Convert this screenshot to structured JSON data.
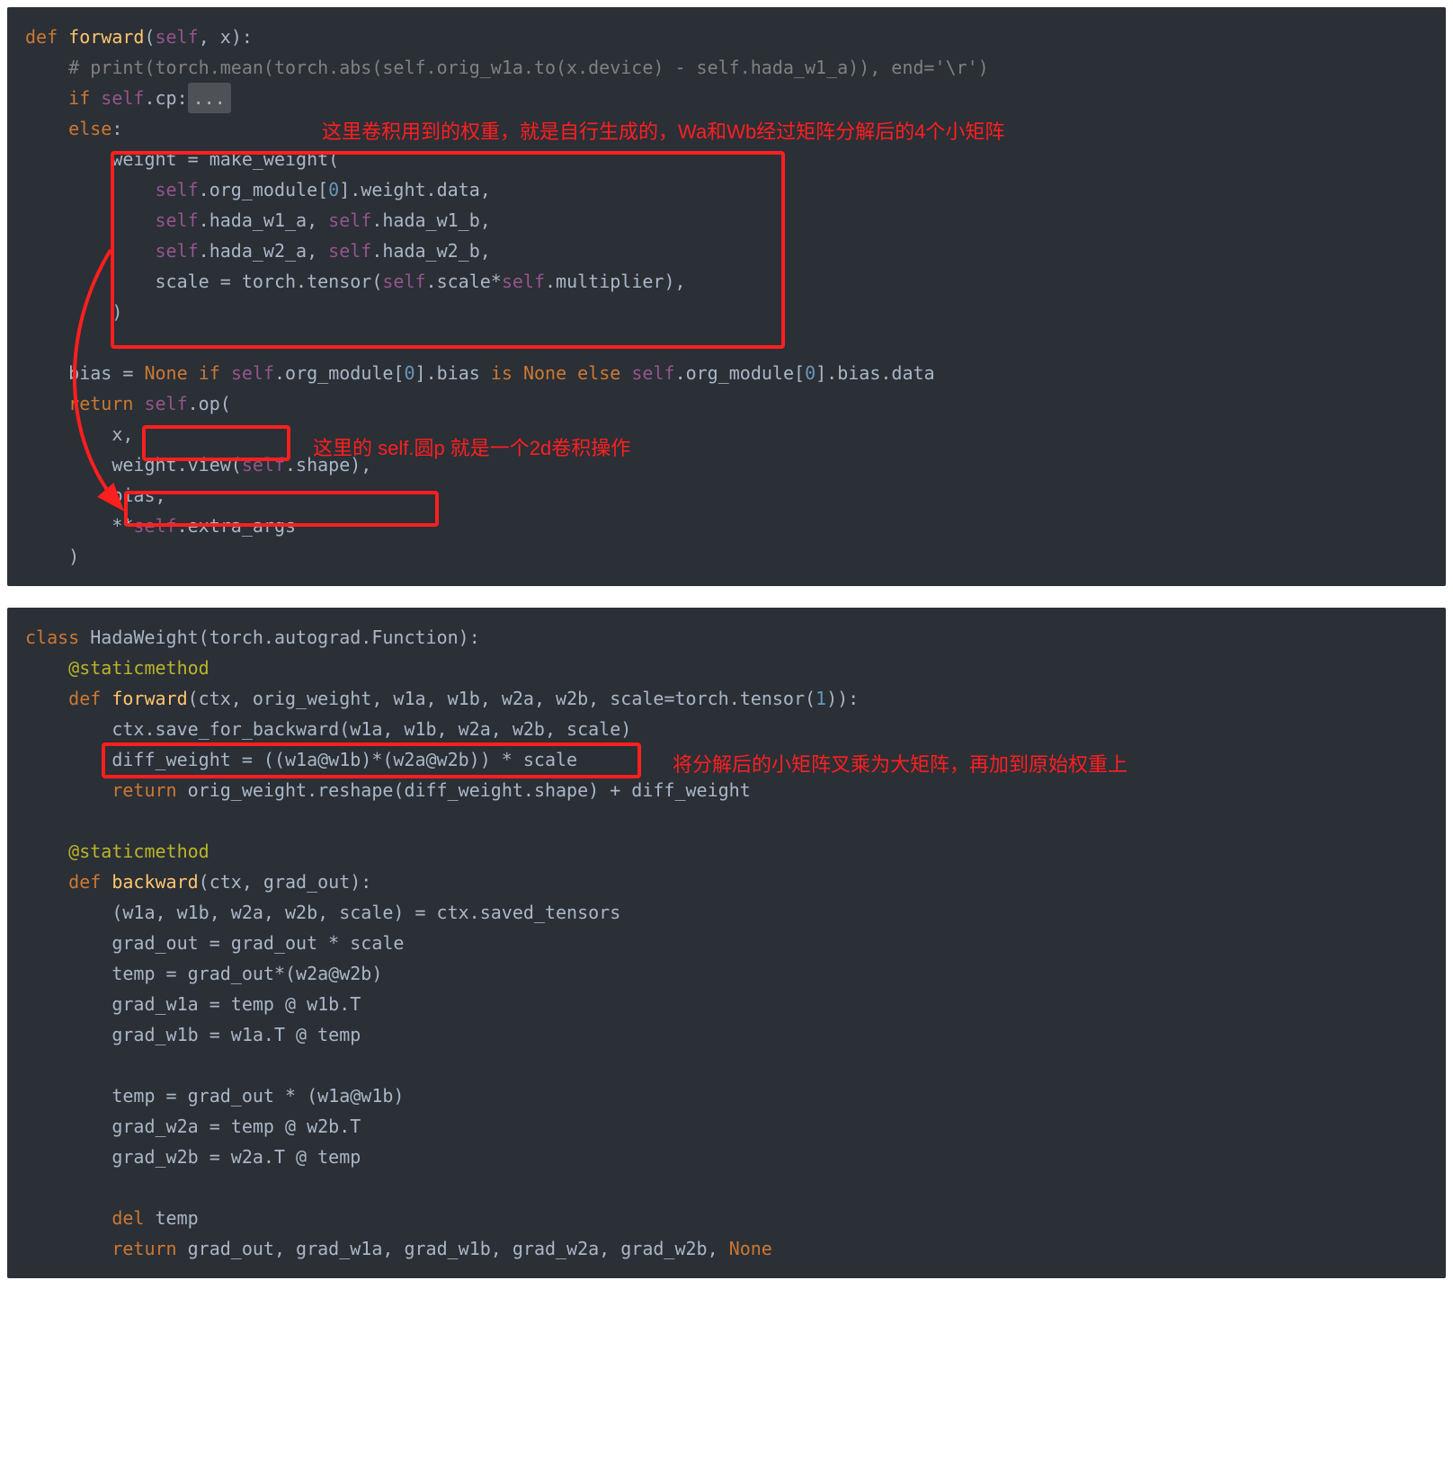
{
  "block1": {
    "annotations": {
      "top": "这里卷积用到的权重，就是自行生成的，Wa和Wb经过矩阵分解后的4个小矩阵",
      "mid": "这里的 self.圆p 就是一个2d卷积操作"
    },
    "collapse": "...",
    "lines": {
      "l0": {
        "def": "def ",
        "fn": "forward",
        "p": "(",
        "self": "self",
        "comma": ", ",
        "x": "x):"
      },
      "l1": "# print(torch.mean(torch.abs(self.orig_w1a.to(x.device) - self.hada_w1_a)), end='\\r')",
      "l2": {
        "a": "if ",
        "s": "self",
        "b": ".cp:"
      },
      "l3": {
        "a": "else",
        "b": ":"
      },
      "l4": "weight = make_weight(",
      "l5": {
        "s": "self",
        "t": ".org_module[",
        "n": "0",
        "u": "].weight.data,"
      },
      "l6": {
        "s1": "self",
        "a": ".hada_w1_a, ",
        "s2": "self",
        "b": ".hada_w1_b,"
      },
      "l7": {
        "s1": "self",
        "a": ".hada_w2_a, ",
        "s2": "self",
        "b": ".hada_w2_b,"
      },
      "l8": {
        "a": "scale = torch.tensor(",
        "s1": "self",
        "b": ".scale*",
        "s2": "self",
        "c": ".multiplier),"
      },
      "l9": ")",
      "l10": {
        "a": "bias = ",
        "none": "None ",
        "b": "if ",
        "s1": "self",
        "c": ".org_module[",
        "n": "0",
        "d": "].bias ",
        "e": "is ",
        "none2": "None ",
        "f": "else ",
        "s2": "self",
        "g": ".org_module[",
        "n2": "0",
        "h": "].bias.data"
      },
      "l11": {
        "a": "return ",
        "s": "self",
        "b": ".op("
      },
      "l12": "x,",
      "l13": {
        "a": "weight.view(",
        "s": "self",
        "b": ".shape),"
      },
      "l14": "bias,",
      "l15": {
        "a": "**",
        "s": "self",
        "b": ".extra_args"
      },
      "l16": ")"
    }
  },
  "block2": {
    "annotations": {
      "a1": "将分解后的小矩阵叉乘为大矩阵，再加到原始权重上"
    },
    "lines": {
      "l0": {
        "a": "class ",
        "b": "HadaWeight",
        "c": "(torch.autograd.Function):"
      },
      "l1": "@staticmethod",
      "l2": {
        "a": "def ",
        "fn": "forward",
        "b": "(ctx, orig_weight, w1a, w1b, w2a, w2b, scale=torch.tensor(",
        "n": "1",
        "c": ")):"
      },
      "l3": "ctx.save_for_backward(w1a, w1b, w2a, w2b, scale)",
      "l4": "diff_weight = ((w1a@w1b)*(w2a@w2b)) * scale",
      "l5": {
        "a": "return ",
        "b": "orig_weight.reshape(diff_weight.shape) + diff_weight"
      },
      "l6": "@staticmethod",
      "l7": {
        "a": "def ",
        "fn": "backward",
        "b": "(ctx, grad_out):"
      },
      "l8": "(w1a, w1b, w2a, w2b, scale) = ctx.saved_tensors",
      "l9": "grad_out = grad_out * scale",
      "l10": "temp = grad_out*(w2a@w2b)",
      "l11": "grad_w1a = temp @ w1b.T",
      "l12": "grad_w1b = w1a.T @ temp",
      "l13": "temp = grad_out * (w1a@w1b)",
      "l14": "grad_w2a = temp @ w2b.T",
      "l15": "grad_w2b = w2a.T @ temp",
      "l16": {
        "a": "del ",
        "b": "temp"
      },
      "l17": {
        "a": "return ",
        "b": "grad_out, grad_w1a, grad_w1b, grad_w2a, grad_w2b, ",
        "none": "None"
      }
    }
  }
}
